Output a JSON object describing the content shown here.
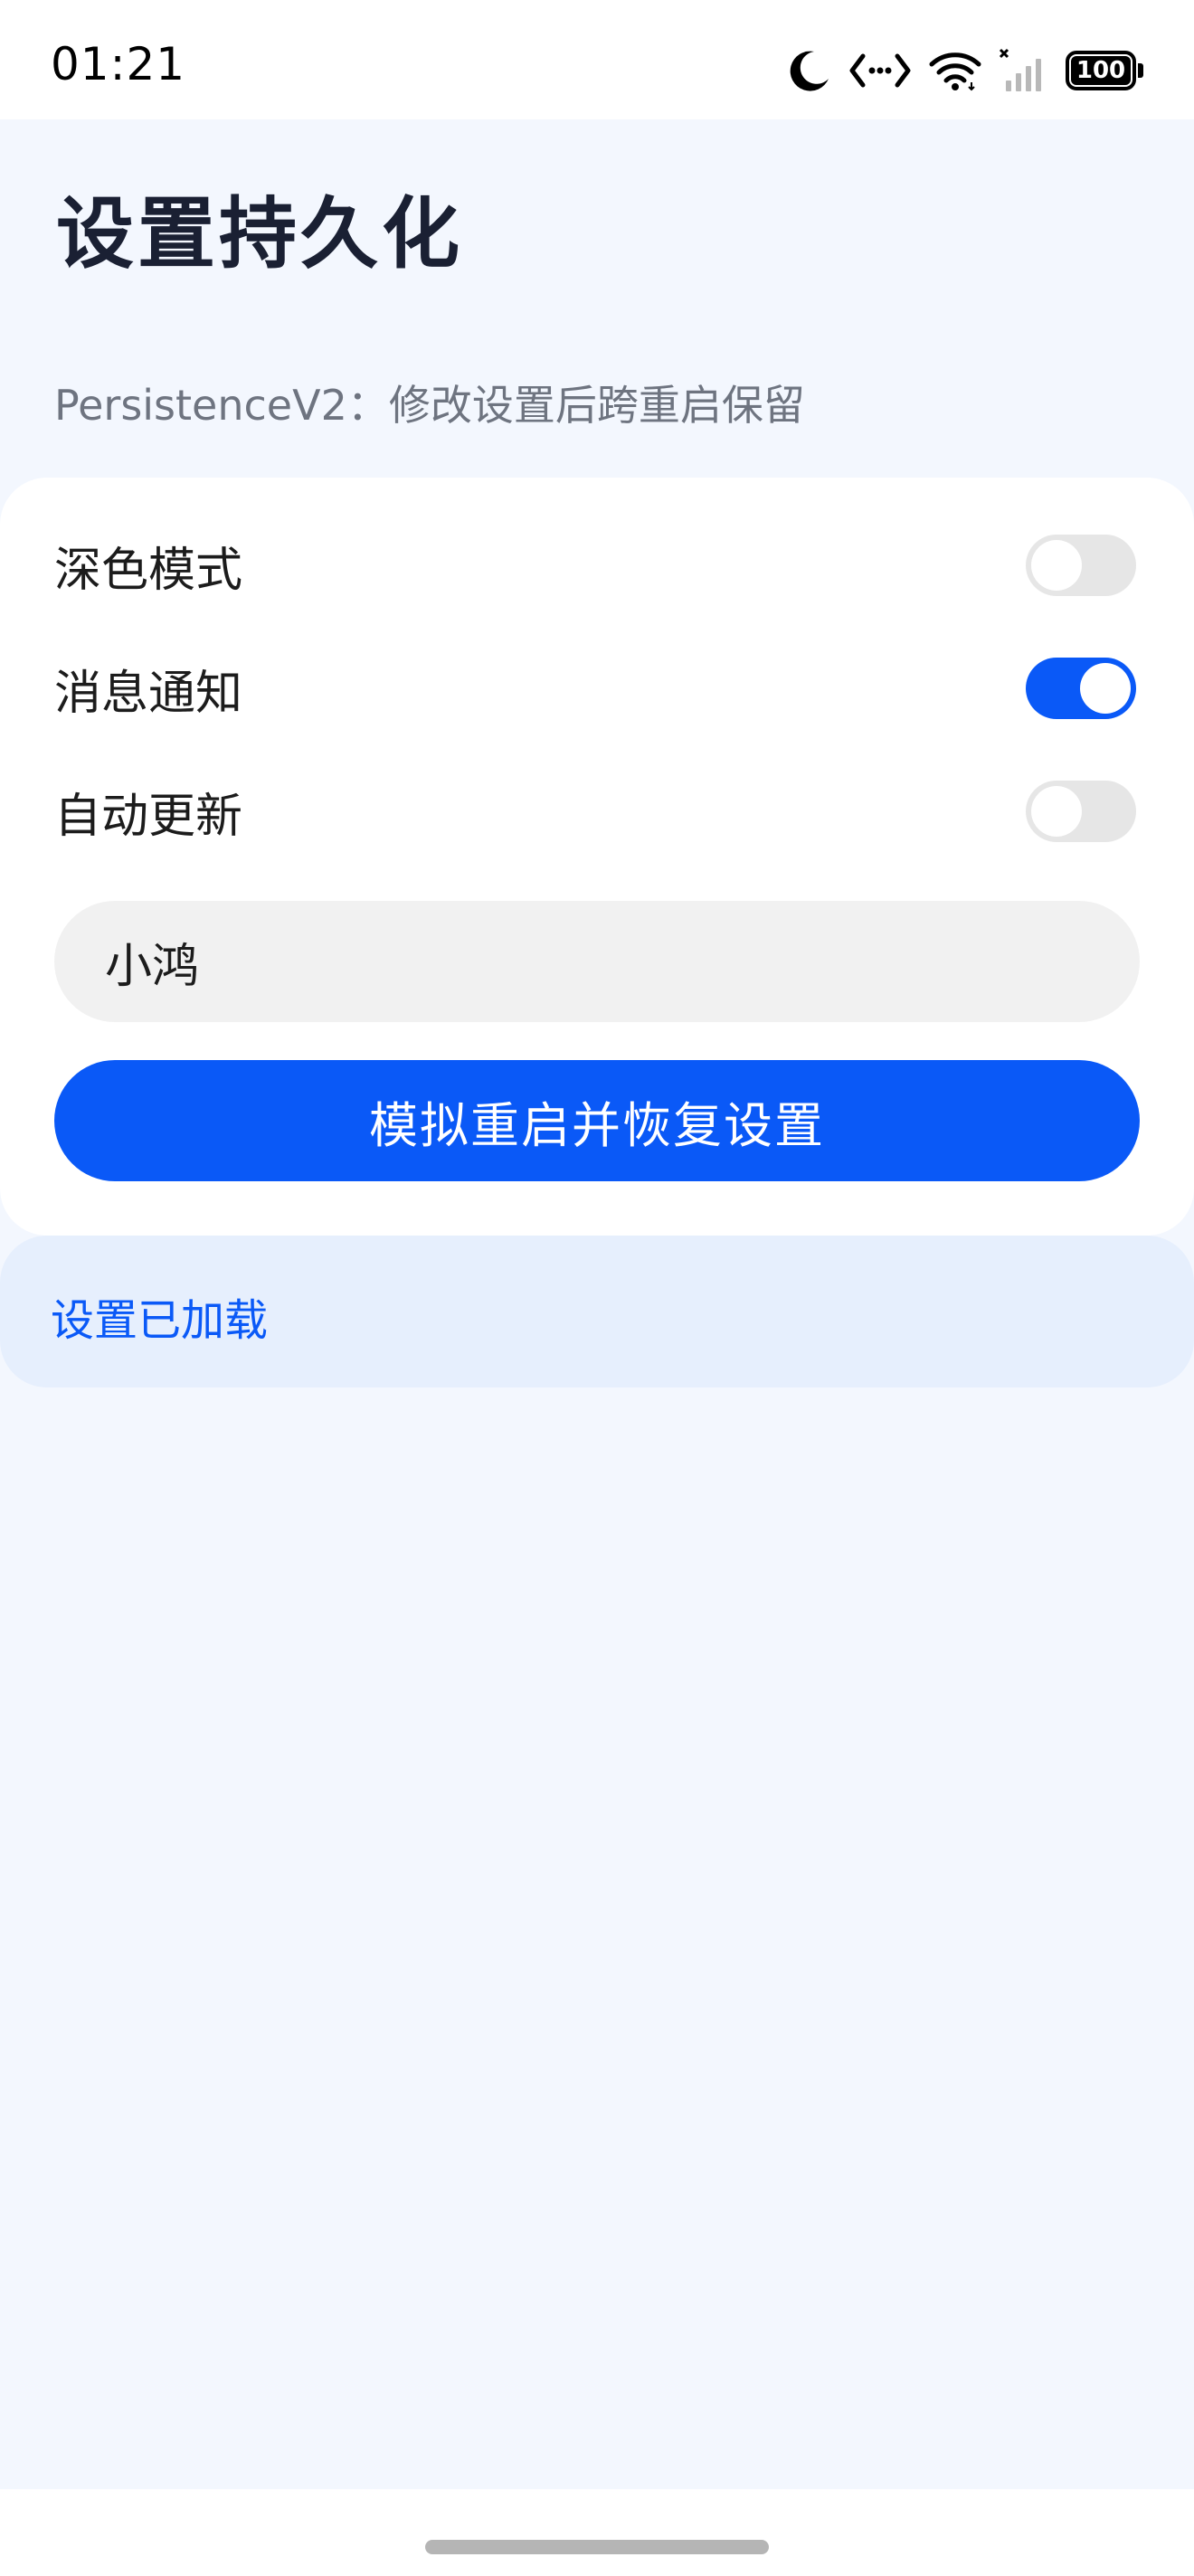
{
  "status_bar": {
    "time": "01:21",
    "battery": "100",
    "icons": [
      "moon-icon",
      "network-sync-icon",
      "wifi-icon",
      "cellular-signal-icon",
      "battery-icon"
    ]
  },
  "header": {
    "title": "设置持久化",
    "subtitle": "PersistenceV2：修改设置后跨重启保留"
  },
  "settings": {
    "items": [
      {
        "label": "深色模式",
        "enabled": false
      },
      {
        "label": "消息通知",
        "enabled": true
      },
      {
        "label": "自动更新",
        "enabled": false
      }
    ],
    "name_value": "小鸿",
    "restore_label": "模拟重启并恢复设置"
  },
  "status": {
    "message": "设置已加载"
  },
  "colors": {
    "accent": "#0A59F7",
    "background": "#F3F7FE",
    "card": "#FFFFFF",
    "status_bg": "#E6EFFD"
  }
}
